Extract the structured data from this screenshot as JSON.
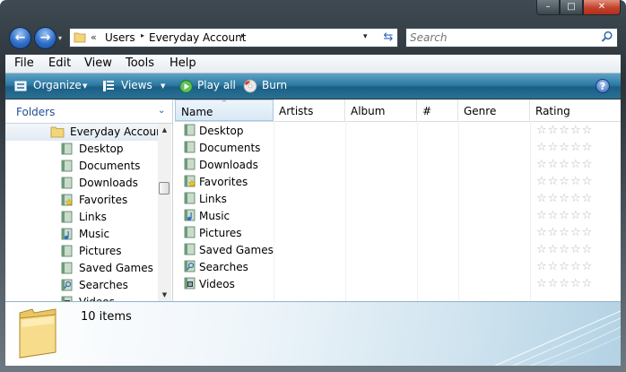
{
  "window": {
    "caption_buttons": {
      "minimize": "–",
      "maximize": "□",
      "close": "✕"
    }
  },
  "nav": {
    "back_glyph": "←",
    "forward_glyph": "→",
    "history_glyph": "▾",
    "address": {
      "chevron": "«",
      "segments": [
        "Users",
        "Everyday Account"
      ],
      "separator": "▸",
      "dropdown_glyph": "▾",
      "refresh_glyph": "⇆"
    },
    "search_placeholder": "Search"
  },
  "menu": {
    "items": [
      "File",
      "Edit",
      "View",
      "Tools",
      "Help"
    ]
  },
  "toolbar": {
    "organize": "Organize",
    "views": "Views",
    "play_all": "Play all",
    "burn": "Burn",
    "dropdown_glyph": "▼",
    "help_glyph": "?"
  },
  "folders_pane": {
    "header": "Folders",
    "toggle_glyph": "⌄",
    "root": "Everyday Account",
    "items": [
      "Desktop",
      "Documents",
      "Downloads",
      "Favorites",
      "Links",
      "Music",
      "Pictures",
      "Saved Games",
      "Searches",
      "Videos"
    ],
    "scroll_up": "▲",
    "scroll_down": "▼"
  },
  "file_list": {
    "columns": [
      "Name",
      "Artists",
      "Album",
      "#",
      "Genre",
      "Rating"
    ],
    "sort_glyph": "^",
    "rows": [
      {
        "name": "Desktop",
        "rating": 0
      },
      {
        "name": "Documents",
        "rating": 0
      },
      {
        "name": "Downloads",
        "rating": 0
      },
      {
        "name": "Favorites",
        "rating": 0
      },
      {
        "name": "Links",
        "rating": 0
      },
      {
        "name": "Music",
        "rating": 0
      },
      {
        "name": "Pictures",
        "rating": 0
      },
      {
        "name": "Saved Games",
        "rating": 0
      },
      {
        "name": "Searches",
        "rating": 0
      },
      {
        "name": "Videos",
        "rating": 0
      }
    ],
    "stars": "☆☆☆☆☆"
  },
  "details": {
    "count": "10 items"
  },
  "colors": {
    "accent": "#1f4f93",
    "toolbar": "#2d7aa3"
  }
}
